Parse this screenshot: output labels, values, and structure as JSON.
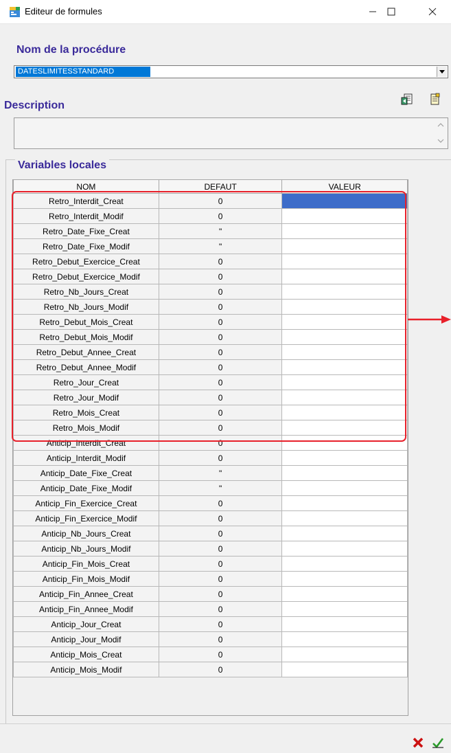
{
  "window": {
    "title": "Editeur de formules",
    "minimize_icon": "minimize-icon",
    "maximize_icon": "maximize-icon",
    "close_icon": "close-icon"
  },
  "procedure": {
    "label": "Nom de la procédure",
    "selected_value": "DATESLIMITESSTANDARD"
  },
  "description": {
    "label": "Description",
    "value": ""
  },
  "variables": {
    "title": "Variables locales",
    "headers": [
      "NOM",
      "DEFAUT",
      "VALEUR"
    ],
    "rows": [
      {
        "nom": "Retro_Interdit_Creat",
        "defaut": "0",
        "valeur": ""
      },
      {
        "nom": "Retro_Interdit_Modif",
        "defaut": "0",
        "valeur": ""
      },
      {
        "nom": "Retro_Date_Fixe_Creat",
        "defaut": "\"",
        "valeur": ""
      },
      {
        "nom": "Retro_Date_Fixe_Modif",
        "defaut": "\"",
        "valeur": ""
      },
      {
        "nom": "Retro_Debut_Exercice_Creat",
        "defaut": "0",
        "valeur": ""
      },
      {
        "nom": "Retro_Debut_Exercice_Modif",
        "defaut": "0",
        "valeur": ""
      },
      {
        "nom": "Retro_Nb_Jours_Creat",
        "defaut": "0",
        "valeur": ""
      },
      {
        "nom": "Retro_Nb_Jours_Modif",
        "defaut": "0",
        "valeur": ""
      },
      {
        "nom": "Retro_Debut_Mois_Creat",
        "defaut": "0",
        "valeur": ""
      },
      {
        "nom": "Retro_Debut_Mois_Modif",
        "defaut": "0",
        "valeur": ""
      },
      {
        "nom": "Retro_Debut_Annee_Creat",
        "defaut": "0",
        "valeur": ""
      },
      {
        "nom": "Retro_Debut_Annee_Modif",
        "defaut": "0",
        "valeur": ""
      },
      {
        "nom": "Retro_Jour_Creat",
        "defaut": "0",
        "valeur": ""
      },
      {
        "nom": "Retro_Jour_Modif",
        "defaut": "0",
        "valeur": ""
      },
      {
        "nom": "Retro_Mois_Creat",
        "defaut": "0",
        "valeur": ""
      },
      {
        "nom": "Retro_Mois_Modif",
        "defaut": "0",
        "valeur": ""
      },
      {
        "nom": "Anticip_Interdit_Creat",
        "defaut": "0",
        "valeur": ""
      },
      {
        "nom": "Anticip_Interdit_Modif",
        "defaut": "0",
        "valeur": ""
      },
      {
        "nom": "Anticip_Date_Fixe_Creat",
        "defaut": "\"",
        "valeur": ""
      },
      {
        "nom": "Anticip_Date_Fixe_Modif",
        "defaut": "\"",
        "valeur": ""
      },
      {
        "nom": "Anticip_Fin_Exercice_Creat",
        "defaut": "0",
        "valeur": ""
      },
      {
        "nom": "Anticip_Fin_Exercice_Modif",
        "defaut": "0",
        "valeur": ""
      },
      {
        "nom": "Anticip_Nb_Jours_Creat",
        "defaut": "0",
        "valeur": ""
      },
      {
        "nom": "Anticip_Nb_Jours_Modif",
        "defaut": "0",
        "valeur": ""
      },
      {
        "nom": "Anticip_Fin_Mois_Creat",
        "defaut": "0",
        "valeur": ""
      },
      {
        "nom": "Anticip_Fin_Mois_Modif",
        "defaut": "0",
        "valeur": ""
      },
      {
        "nom": "Anticip_Fin_Annee_Creat",
        "defaut": "0",
        "valeur": ""
      },
      {
        "nom": "Anticip_Fin_Annee_Modif",
        "defaut": "0",
        "valeur": ""
      },
      {
        "nom": "Anticip_Jour_Creat",
        "defaut": "0",
        "valeur": ""
      },
      {
        "nom": "Anticip_Jour_Modif",
        "defaut": "0",
        "valeur": ""
      },
      {
        "nom": "Anticip_Mois_Creat",
        "defaut": "0",
        "valeur": ""
      },
      {
        "nom": "Anticip_Mois_Modif",
        "defaut": "0",
        "valeur": ""
      }
    ],
    "selected_row": 0
  },
  "toolbar_icons": [
    "import-formula-icon",
    "copy-formula-icon"
  ],
  "actions": {
    "cancel_icon": "cancel-x-icon",
    "ok_icon": "ok-check-icon"
  },
  "colors": {
    "section_label": "#3a2a9a",
    "selection": "#0078d7",
    "highlight_annotation": "#e8202a",
    "cancel": "#cc1111",
    "ok": "#2a9a2a"
  }
}
